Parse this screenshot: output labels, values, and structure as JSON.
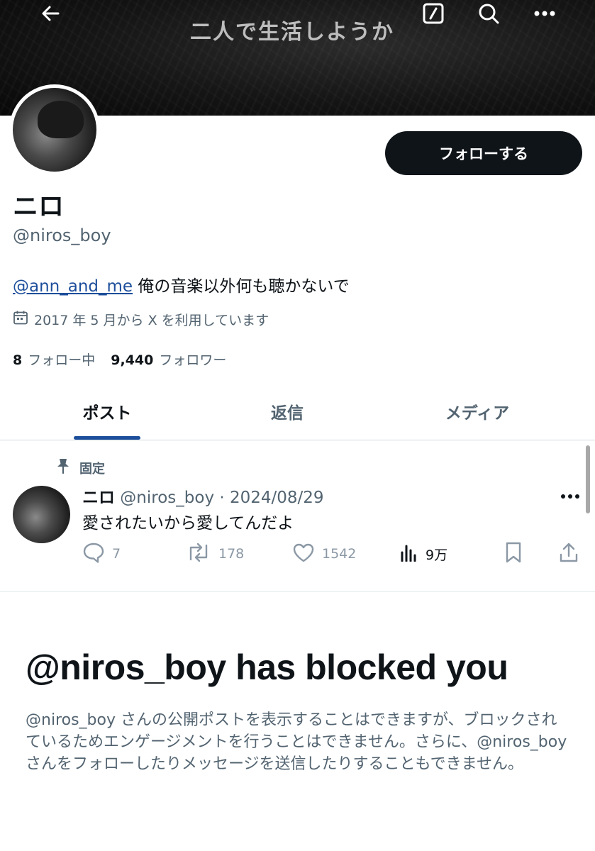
{
  "header": {
    "banner_text": "二人で生活しようか",
    "back_icon": "arrow-left-icon",
    "edit_icon": "slash-box-icon",
    "search_icon": "search-icon",
    "more_icon": "more-horizontal-icon"
  },
  "profile": {
    "display_name": "ニロ",
    "handle": "@niros_boy",
    "follow_label": "フォローする",
    "bio_mention": "@ann_and_me",
    "bio_text": " 俺の音楽以外何も聴かないで",
    "joined": "2017 年 5 月から X を利用しています",
    "following_count": "8",
    "following_label": "フォロー中",
    "followers_count": "9,440",
    "followers_label": "フォロワー"
  },
  "tabs": {
    "posts": "ポスト",
    "replies": "返信",
    "media": "メディア"
  },
  "post": {
    "pinned_label": "固定",
    "author": "ニロ",
    "handle_date": " @niros_boy · 2024/08/29",
    "text": "愛されたいから愛してんだよ",
    "replies": "7",
    "reposts": "178",
    "likes": "1542",
    "views": "9万"
  },
  "blocked": {
    "title": "@niros_boy has blocked you",
    "description": "@niros_boy さんの公開ポストを表示することはできますが、ブロックされているためエンゲージメントを行うことはできません。さらに、@niros_boy さんをフォローしたりメッセージを送信したりすることもできません。"
  },
  "colors": {
    "text_primary": "#0f1419",
    "text_secondary": "#536471",
    "link": "#1d4e9b",
    "follow_button_bg": "#0f1419"
  }
}
